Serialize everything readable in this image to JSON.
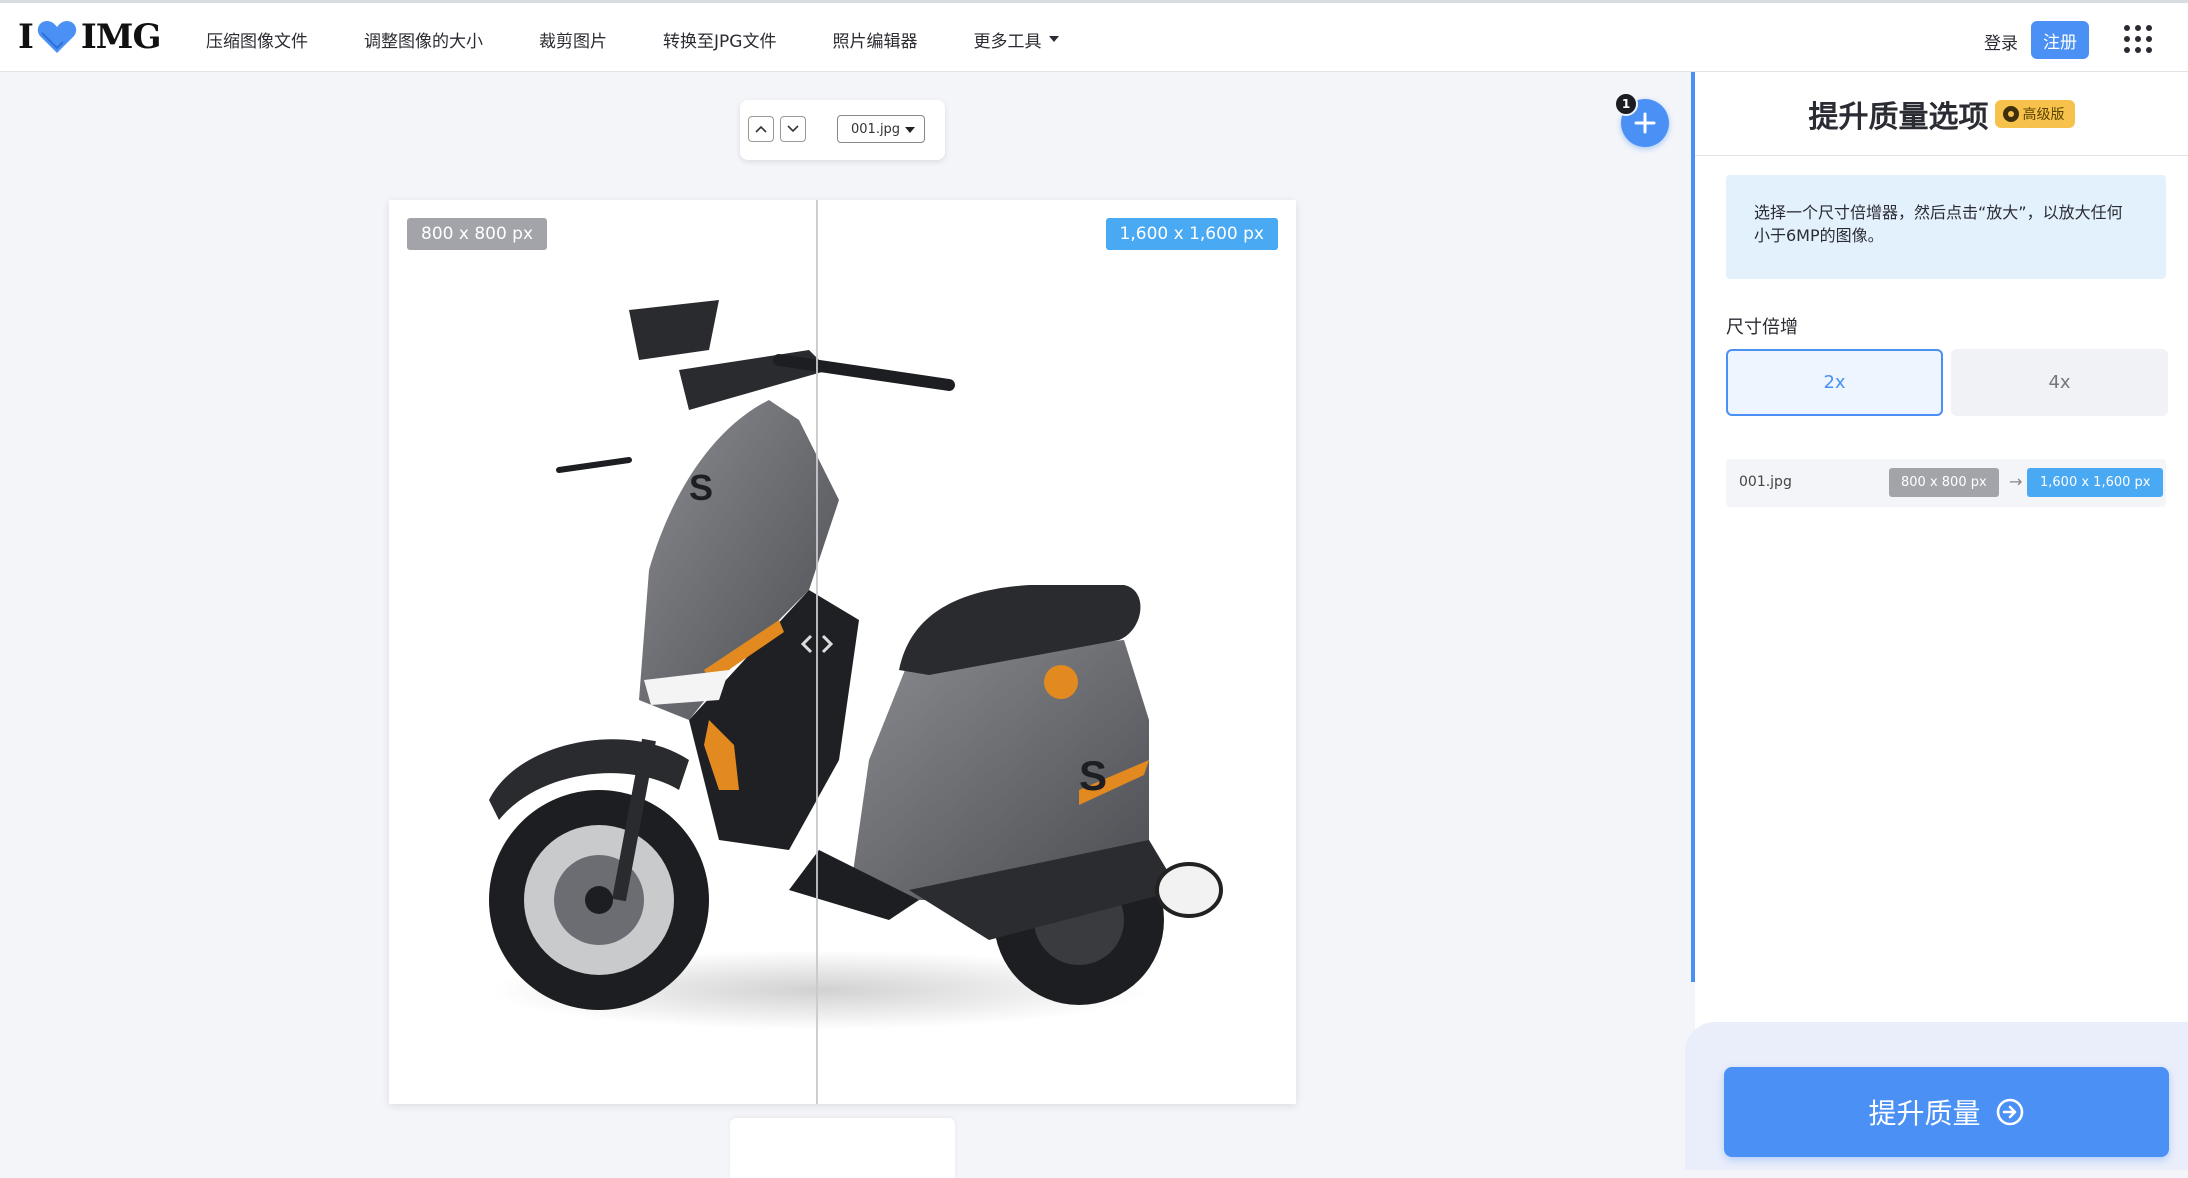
{
  "brand": {
    "logo_left": "I",
    "logo_right": "IMG"
  },
  "nav": {
    "items": [
      {
        "label": "压缩图像文件"
      },
      {
        "label": "调整图像的大小"
      },
      {
        "label": "裁剪图片"
      },
      {
        "label": "转换至JPG文件"
      },
      {
        "label": "照片编辑器"
      },
      {
        "label": "更多工具"
      }
    ],
    "login": "登录",
    "signup": "注册"
  },
  "workspace": {
    "selected_file": "001.jpg",
    "file_count_badge": "1",
    "original_size": "800 x 800 px",
    "upscaled_size": "1,600 x 1,600 px"
  },
  "panel": {
    "title": "提升质量选项",
    "premium_label": "高级版",
    "info": "选择一个尺寸倍增器，然后点击“放大”，以放大任何小于6MP的图像。",
    "multiplier_label": "尺寸倍增",
    "multipliers": [
      {
        "label": "2x",
        "selected": true
      },
      {
        "label": "4x",
        "selected": false
      }
    ],
    "file_row": {
      "name": "001.jpg",
      "from": "800 x 800 px",
      "arrow": "→",
      "to": "1,600 x 1,600 px"
    },
    "action": "提升质量"
  },
  "colors": {
    "accent": "#4a90f5",
    "tag_blue": "#49a9f3",
    "tag_grey": "#a3a4a9",
    "premium": "#f7c24b",
    "info_bg": "#e3f1fd"
  }
}
